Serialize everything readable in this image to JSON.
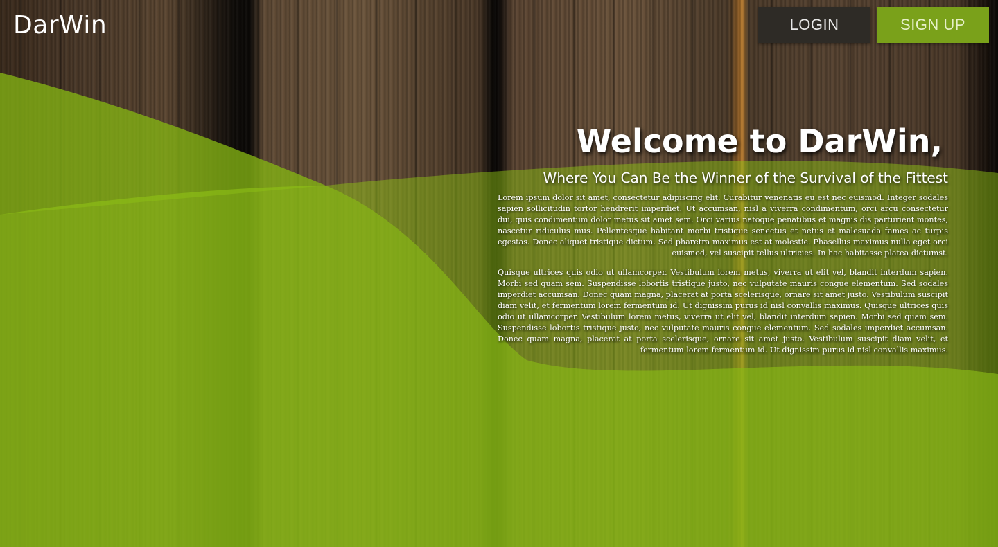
{
  "header": {
    "brand": "DarWin",
    "login_label": "LOGIN",
    "signup_label": "SIGN UP"
  },
  "hero": {
    "title": "Welcome to DarWin,",
    "subtitle": "Where You Can Be the Winner of the Survival of the Fittest",
    "paragraphs": [
      "Lorem ipsum dolor sit amet, consectetur adipiscing elit. Curabitur venenatis eu est nec euismod. Integer sodales sapien sollicitudin tortor hendrerit imperdiet. Ut accumsan, nisl a viverra condimentum, orci arcu consectetur dui, quis condimentum dolor metus sit amet sem. Orci varius natoque penatibus et magnis dis parturient montes, nascetur ridiculus mus. Pellentesque habitant morbi tristique senectus et netus et malesuada fames ac turpis egestas. Donec aliquet tristique dictum. Sed pharetra maximus est at molestie. Phasellus maximus nulla eget orci euismod, vel suscipit tellus ultricies. In hac habitasse platea dictumst.",
      "Quisque ultrices quis odio ut ullamcorper. Vestibulum lorem metus, viverra ut elit vel, blandit interdum sapien. Morbi sed quam sem. Suspendisse lobortis tristique justo, nec vulputate mauris congue elementum. Sed sodales imperdiet accumsan. Donec quam magna, placerat at porta scelerisque, ornare sit amet justo. Vestibulum suscipit diam velit, et fermentum lorem fermentum id. Ut dignissim purus id nisl convallis maximus. Quisque ultrices quis odio ut ullamcorper. Vestibulum lorem metus, viverra ut elit vel, blandit interdum sapien. Morbi sed quam sem. Suspendisse lobortis tristique justo, nec vulputate mauris congue elementum. Sed sodales imperdiet accumsan. Donec quam magna, placerat at porta scelerisque, ornare sit amet justo. Vestibulum suscipit diam velit, et fermentum lorem fermentum id. Ut dignissim purus id nisl convallis maximus."
    ]
  },
  "colors": {
    "accent_green": "#7aa11a",
    "login_bg": "#2e2b26",
    "overlay_green": "#8fbd0f",
    "text": "#ffffff"
  }
}
